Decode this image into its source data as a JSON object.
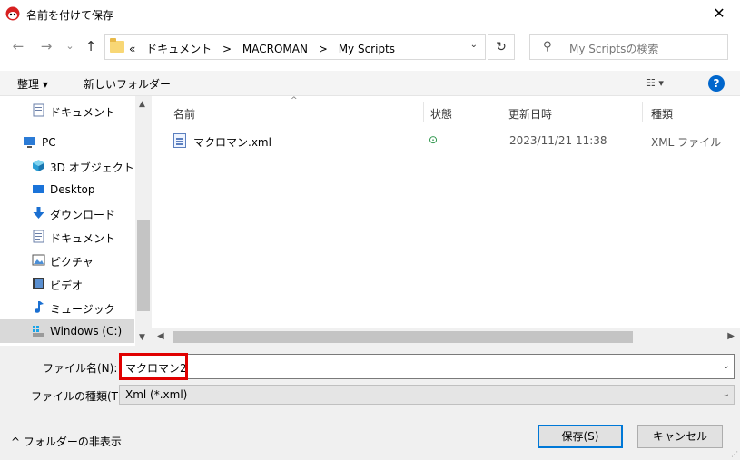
{
  "window": {
    "title": "名前を付けて保存",
    "close_glyph": "✕"
  },
  "nav": {
    "back_glyph": "←",
    "forward_glyph": "→",
    "recent_glyph": "⌄",
    "up_glyph": "↑",
    "overflow": "«",
    "breadcrumbs": [
      "ドキュメント",
      ">",
      "MACROMAN",
      ">",
      "My Scripts"
    ],
    "address_dropdown": "⌄",
    "refresh_glyph": "↻",
    "search_placeholder": "My Scriptsの検索"
  },
  "toolbar": {
    "organize": "整理 ▾",
    "new_folder": "新しいフォルダー",
    "view_glyph": "☷ ▾",
    "help": "?"
  },
  "sidebar": {
    "items": [
      {
        "label": "ドキュメント",
        "icon": "document-icon"
      },
      {
        "label": "PC",
        "icon": "pc-icon"
      },
      {
        "label": "3D オブジェクト",
        "icon": "cube-icon"
      },
      {
        "label": "Desktop",
        "icon": "desktop-icon"
      },
      {
        "label": "ダウンロード",
        "icon": "download-icon"
      },
      {
        "label": "ドキュメント",
        "icon": "document-icon"
      },
      {
        "label": "ピクチャ",
        "icon": "picture-icon"
      },
      {
        "label": "ビデオ",
        "icon": "video-icon"
      },
      {
        "label": "ミュージック",
        "icon": "music-icon"
      },
      {
        "label": "Windows (C:)",
        "icon": "drive-icon"
      }
    ]
  },
  "filelist": {
    "columns": [
      "名前",
      "状態",
      "更新日時",
      "種類"
    ],
    "sort_glyph": "^",
    "rows": [
      {
        "name": "マクロマン.xml",
        "status": "⊙",
        "modified": "2023/11/21 11:38",
        "type": "XML ファイル"
      }
    ]
  },
  "form": {
    "filename_label": "ファイル名(N):",
    "filename_value": "マクロマン2",
    "filetype_label": "ファイルの種類(T):",
    "filetype_value": "Xml (*.xml)",
    "dropdown_glyph": "⌄"
  },
  "footer": {
    "hide_folders": "^ フォルダーの非表示",
    "save": "保存(S)",
    "cancel": "キャンセル"
  },
  "colors": {
    "accent": "#0078d7",
    "highlight": "#e00000",
    "help": "#0066cc"
  }
}
